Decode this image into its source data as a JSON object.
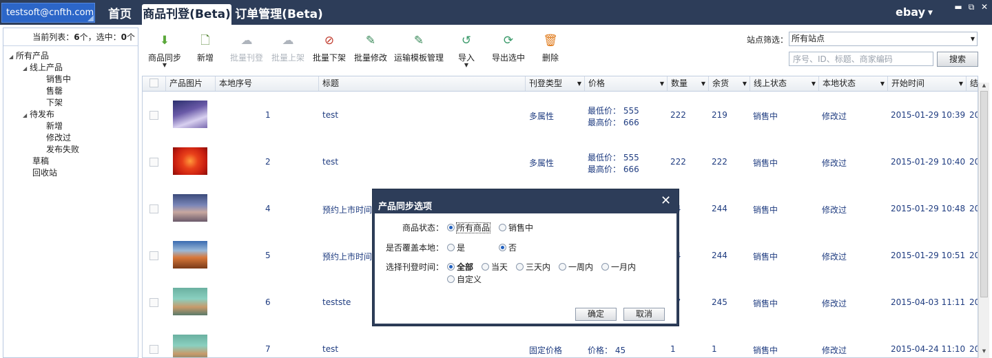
{
  "topbar": {
    "user": "testsoft@cnfth.com",
    "tabs": [
      "首页",
      "商品刊登(Beta)",
      "订单管理(Beta)"
    ],
    "active_tab": "商品刊登(Beta)",
    "platform": "ebay",
    "window_controls": [
      "minimize-icon",
      "restore-icon",
      "close-icon"
    ]
  },
  "sidebar": {
    "list_prefix": "当前列表：",
    "list_count": "6",
    "list_mid": "个，选中：",
    "selected_count": "0",
    "list_suffix": "个",
    "tree": [
      {
        "label": "所有产品",
        "expanded": true
      },
      {
        "label": "线上产品",
        "expanded": true
      },
      {
        "label": "销售中"
      },
      {
        "label": "售罄"
      },
      {
        "label": "下架"
      },
      {
        "label": "待发布",
        "expanded": true
      },
      {
        "label": "新增"
      },
      {
        "label": "修改过"
      },
      {
        "label": "发布失败"
      },
      {
        "label": "草稿"
      },
      {
        "label": "回收站"
      }
    ]
  },
  "toolbar": {
    "buttons": [
      {
        "label": "商品同步",
        "icon": "sync-down-icon",
        "enabled": true,
        "dropdown": true
      },
      {
        "label": "新增",
        "icon": "add-document-icon",
        "enabled": true
      },
      {
        "label": "批量刊登",
        "icon": "publish-icon",
        "enabled": false
      },
      {
        "label": "批量上架",
        "icon": "list-up-icon",
        "enabled": false
      },
      {
        "label": "批量下架",
        "icon": "delist-icon",
        "enabled": true
      },
      {
        "label": "批量修改",
        "icon": "batch-edit-icon",
        "enabled": true
      },
      {
        "label": "运输模板管理",
        "icon": "shipping-template-icon",
        "enabled": true
      },
      {
        "label": "导入",
        "icon": "import-icon",
        "enabled": true,
        "dropdown": true
      },
      {
        "label": "导出选中",
        "icon": "export-icon",
        "enabled": true
      },
      {
        "label": "删除",
        "icon": "delete-icon",
        "enabled": true
      }
    ],
    "site_filter_label": "站点筛选：",
    "site_filter_value": "所有站点",
    "search_placeholder": "序号、ID、标题、商家编码",
    "search_button": "搜索"
  },
  "grid": {
    "columns": [
      "产品图片",
      "本地序号",
      "标题",
      "刊登类型",
      "价格",
      "数量",
      "余货",
      "线上状态",
      "本地状态",
      "开始时间",
      "结"
    ],
    "rows": [
      {
        "seq": "1",
        "title": "test",
        "type": "多属性",
        "price_lines": [
          "最低价： 555",
          "最高价： 666"
        ],
        "qty": "222",
        "stock": "219",
        "online": "销售中",
        "local": "修改过",
        "start": "2015-01-29 10:39",
        "end": "20"
      },
      {
        "seq": "2",
        "title": "test",
        "type": "多属性",
        "price_lines": [
          "最低价： 555",
          "最高价： 666"
        ],
        "qty": "222",
        "stock": "222",
        "online": "销售中",
        "local": "修改过",
        "start": "2015-01-29 10:40",
        "end": "20"
      },
      {
        "seq": "4",
        "title": "预约上市时间",
        "type": "",
        "price_lines": [],
        "qty": "44",
        "stock": "244",
        "online": "销售中",
        "local": "修改过",
        "start": "2015-01-29 10:48",
        "end": "20"
      },
      {
        "seq": "5",
        "title": "预约上市时间",
        "type": "",
        "price_lines": [],
        "qty": "44",
        "stock": "244",
        "online": "销售中",
        "local": "修改过",
        "start": "2015-01-29 10:51",
        "end": "20"
      },
      {
        "seq": "6",
        "title": "testste",
        "type": "",
        "price_lines": [],
        "qty": "47",
        "stock": "245",
        "online": "销售中",
        "local": "修改过",
        "start": "2015-04-03 11:11",
        "end": "20"
      },
      {
        "seq": "7",
        "title": "test",
        "type": "固定价格",
        "price_lines": [
          "价格： 45"
        ],
        "qty": "1",
        "stock": "1",
        "online": "销售中",
        "local": "修改过",
        "start": "2015-04-24 11:10",
        "end": "20"
      }
    ]
  },
  "dialog": {
    "title": "产品同步选项",
    "status_label": "商品状态：",
    "status_options": [
      "所有商品",
      "销售中"
    ],
    "status_selected": 0,
    "overwrite_label": "是否覆盖本地：",
    "overwrite_options": [
      "是",
      "否"
    ],
    "overwrite_selected": 1,
    "time_label": "选择刊登时间：",
    "time_options": [
      "全部",
      "当天",
      "三天内",
      "一周内",
      "一月内",
      "自定义"
    ],
    "time_selected": 0,
    "ok": "确定",
    "cancel": "取消"
  }
}
